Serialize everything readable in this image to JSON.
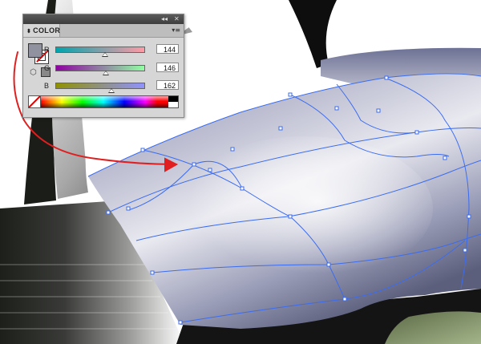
{
  "panel": {
    "title": "COLOR",
    "collapse_glyph": "◂◂",
    "close_glyph": "✕",
    "menu_glyph": "▾≡",
    "fill_color": "#90929f",
    "sliders": [
      {
        "label": "R",
        "value": "144",
        "fraction": 0.565,
        "gradient": "linear-gradient(to right,#00a4ad,#ff9aa6)"
      },
      {
        "label": "G",
        "value": "146",
        "fraction": 0.573,
        "gradient": "linear-gradient(to right,#8f00a2,#8fffa2)"
      },
      {
        "label": "B",
        "value": "162",
        "fraction": 0.635,
        "gradient": "linear-gradient(to right,#909200,#9092ff)"
      }
    ]
  },
  "artwork": {
    "mesh_color": "#3b6cf0",
    "arrow_color": "#e02020",
    "surface_color": "#8b8ea8"
  },
  "icons": {
    "cube": "⬡"
  }
}
